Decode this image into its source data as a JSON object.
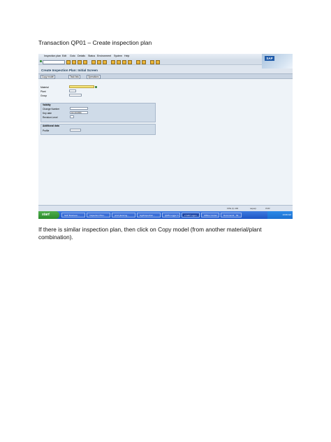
{
  "heading": "Transaction QP01 – Create inspection plan",
  "paragraph": "If there is similar inspection plan, then click on Copy model  (from another material/plant combination).",
  "sap": {
    "menu": [
      "Inspection plan",
      "Edit",
      "Goto",
      "Details",
      "Status",
      "Environment",
      "System",
      "Help"
    ],
    "logo": "SAP",
    "screen_title": "Create Inspection Plan: Initial Screen",
    "app_buttons": [
      "Copy model",
      "Task lists",
      "Operations"
    ],
    "fields": {
      "material": "Material",
      "plant": "Plant",
      "group": "Group"
    },
    "validity": {
      "title": "Validity",
      "change_number": "Change Number",
      "key_date": "Key date",
      "key_date_value": "14.10.2011",
      "revision_level": "Revision Level"
    },
    "additional_data": {
      "title": "Additional data",
      "profile": "Profile"
    },
    "status": {
      "sid": "FPE (1) 400",
      "host": "saperp",
      "mode": "OVR"
    },
    "taskbar": {
      "start": "start",
      "tasks": [
        "SAP Business ...",
        "Inspection Plan...",
        "prod.planning...",
        "log2inspection...",
        "QMS Logger F...",
        "2 SAP Logon ...",
        "Offline Conten...",
        "Document1 - Mi..."
      ],
      "active_index": 5,
      "clock": "10:08 AM"
    }
  }
}
